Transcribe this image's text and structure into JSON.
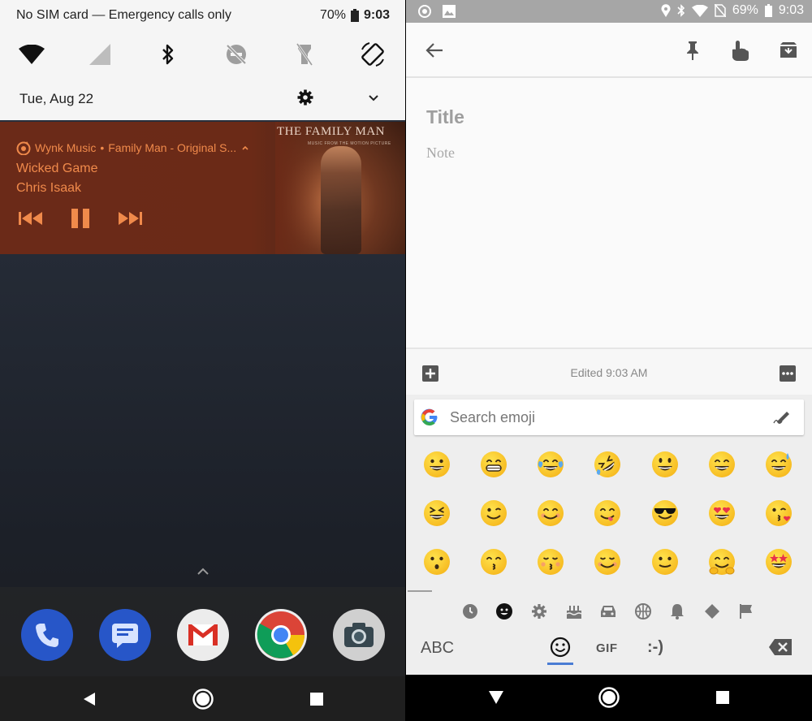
{
  "left": {
    "status": {
      "carrier": "No SIM card — Emergency calls only",
      "battery": "70%",
      "time": "9:03"
    },
    "date": "Tue, Aug 22",
    "media": {
      "app": "Wynk Music",
      "source": "Family Man - Original S...",
      "song": "Wicked Game",
      "artist": "Chris Isaak",
      "album_art_title": "THE FAMILY MAN",
      "album_art_subtitle": "MUSIC FROM THE MOTION PICTURE",
      "accent": "#f08a4b"
    },
    "dock": [
      "phone-app",
      "messages-app",
      "gmail-app",
      "chrome-app",
      "camera-app"
    ]
  },
  "right": {
    "status": {
      "battery": "69%",
      "time": "9:03"
    },
    "note": {
      "title_placeholder": "Title",
      "body_placeholder": "Note",
      "edited": "Edited 9:03 AM"
    },
    "keyboard": {
      "search_placeholder": "Search emoji",
      "abc_label": "ABC",
      "gif_label": "GIF",
      "emoticon_label": ":-)",
      "emoji_rows": [
        [
          "grinning",
          "beaming",
          "tears-of-joy",
          "rolling-laughing",
          "smiley",
          "smile",
          "sweat-smile"
        ],
        [
          "squinting-laugh",
          "winking",
          "blush",
          "savoring",
          "sunglasses",
          "heart-eyes",
          "kissing-heart"
        ],
        [
          "kissing",
          "kissing-smiling-eyes",
          "kissing-closed-eyes",
          "relaxed",
          "slight-smile",
          "hugging",
          "star-struck"
        ]
      ]
    }
  }
}
